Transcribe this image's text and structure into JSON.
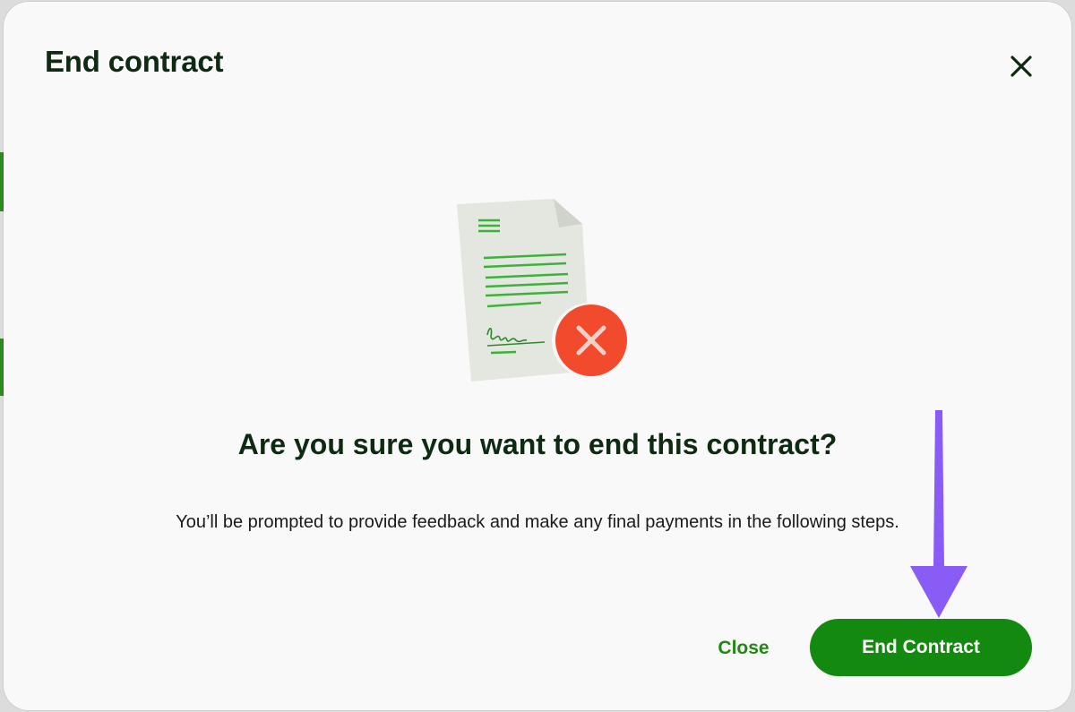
{
  "modal": {
    "title": "End contract",
    "heading": "Are you sure you want to end this contract?",
    "description": "You’ll be prompted to provide feedback and make any final payments in the following steps.",
    "close_label": "Close",
    "confirm_label": "End Contract"
  },
  "icons": {
    "close": "close-icon",
    "illustration": "contract-document-cancel-illustration",
    "annotation": "arrow-down-annotation"
  },
  "colors": {
    "primary_green": "#14890f",
    "title_text": "#0f2a13",
    "cancel_red": "#f14a2c",
    "annotation_purple": "#8a5cf6"
  }
}
